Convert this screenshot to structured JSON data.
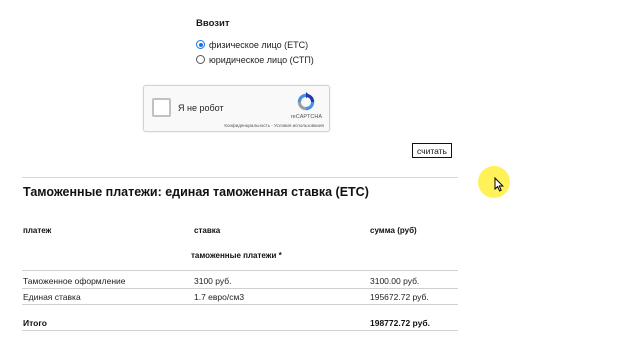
{
  "importer": {
    "title": "Ввозит",
    "options": [
      {
        "label": "физическое лицо (ЕТС)",
        "checked": true
      },
      {
        "label": "юридическое лицо (СТП)",
        "checked": false
      }
    ]
  },
  "captcha": {
    "label": "Я не робот",
    "brand": "reCAPTCHA",
    "links": "Конфиденциальность - Условия использования"
  },
  "calculate_button": "считать",
  "result": {
    "title": "Таможенные платежи: единая таможенная ставка (ЕТС)",
    "columns": [
      "платеж",
      "ставка",
      "сумма (руб)"
    ],
    "subheading": "таможенные платежи *",
    "rows": [
      {
        "payment": "Таможенное оформление",
        "rate": "3100 руб.",
        "amount": "3100.00 руб."
      },
      {
        "payment": "Единая ставка",
        "rate": "1.7 евро/см3",
        "amount": "195672.72 руб."
      }
    ],
    "total": {
      "label": "Итого",
      "amount": "198772.72 руб."
    }
  },
  "colors": {
    "accent": "#1a73e8",
    "cursor_highlight": "#fff03c"
  }
}
